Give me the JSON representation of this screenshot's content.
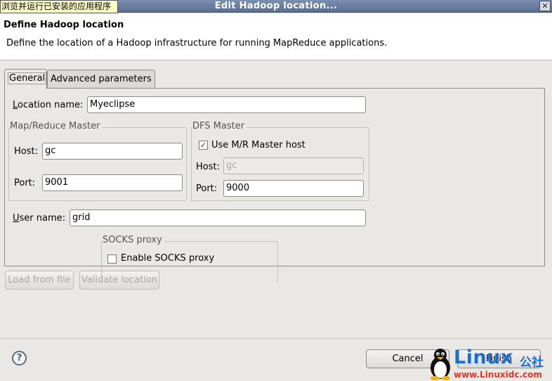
{
  "window": {
    "title": "Edit Hadoop location...",
    "close_glyph": "✕",
    "tooltip": "浏览并运行已安装的应用程序"
  },
  "header": {
    "title": "Define Hadoop location",
    "description": "Define the location of a Hadoop infrastructure for running MapReduce applications."
  },
  "tabs": [
    {
      "label": "General",
      "active": true
    },
    {
      "label": "Advanced parameters",
      "active": false
    }
  ],
  "general": {
    "location_name": {
      "label_first": "L",
      "label_rest": "ocation name:",
      "value": "Myeclipse"
    },
    "mapreduce_master": {
      "legend": "Map/Reduce Master",
      "host_label": "Host:",
      "host_value": "gc",
      "port_label": "Port:",
      "port_value": "9001"
    },
    "dfs_master": {
      "legend": "DFS Master",
      "use_mr_label": "Use M/R Master host",
      "use_mr_checked": true,
      "check_glyph": "✓",
      "host_label": "Host:",
      "host_value": "gc",
      "port_label": "Port:",
      "port_value": "9000"
    },
    "user_name": {
      "label_first": "U",
      "label_rest": "ser name:",
      "value": "grid"
    },
    "socks_proxy": {
      "legend": "SOCKS proxy",
      "enable_label": "Enable SOCKS proxy",
      "enabled": false
    }
  },
  "buttons": {
    "load_from_file": "Load from file",
    "validate_location": "Validate location",
    "cancel": "Cancel",
    "finish": "Finish"
  },
  "help_glyph": "?",
  "watermark": {
    "brand": "Linux",
    "cjk": "公社",
    "url": "www.Linuxidc.com"
  },
  "colors": {
    "titlebar": "#5a6f91",
    "dialog_bg": "#e9e8e5",
    "watermark_blue": "#1c6fd0",
    "watermark_red": "#d23a2a"
  }
}
